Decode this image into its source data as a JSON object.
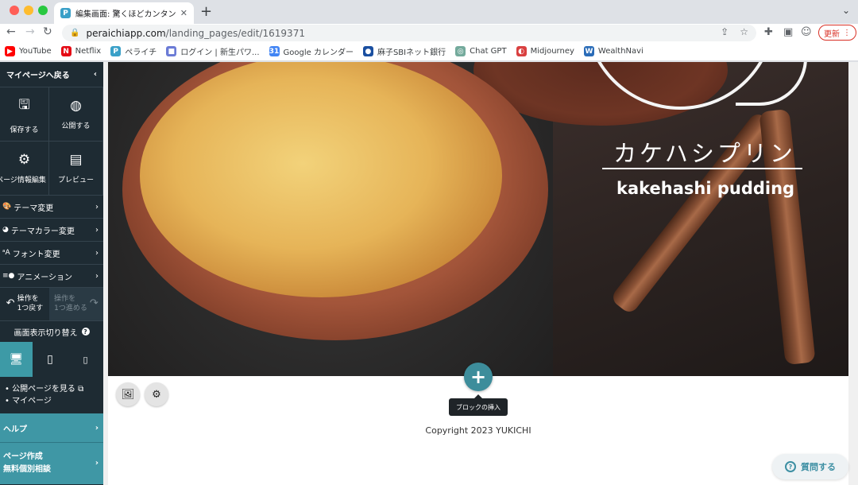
{
  "browser": {
    "tab_title": "編集画面: 驚くほどカンタン！無料",
    "tab_close": "✕",
    "new_tab": "+",
    "url_host": "peraichiapp.com",
    "url_path": "/landing_pages/edit/1619371",
    "update_label": "更新",
    "bookmarks": [
      {
        "label": "YouTube",
        "icon": "youtube-icon",
        "color": "#ff0000"
      },
      {
        "label": "Netflix",
        "icon": "netflix-icon",
        "color": "#e50914"
      },
      {
        "label": "ペライチ",
        "icon": "peraichi-icon",
        "color": "#3aa0c8"
      },
      {
        "label": "ログイン | 新生パワ...",
        "icon": "login-icon",
        "color": "#6b7bd6"
      },
      {
        "label": "Google カレンダー",
        "icon": "calendar-icon",
        "color": "#4285f4"
      },
      {
        "label": "麻子SBIネット銀行",
        "icon": "bank-icon",
        "color": "#1a4fa0"
      },
      {
        "label": "Chat GPT",
        "icon": "chatgpt-icon",
        "color": "#74aa9c"
      },
      {
        "label": "Midjourney",
        "icon": "midjourney-icon",
        "color": "#d94040"
      },
      {
        "label": "WealthNavi",
        "icon": "wealthnavi-icon",
        "color": "#2a6cb8"
      }
    ]
  },
  "sidebar": {
    "back_label": "マイページへ戻る",
    "save_label": "保存する",
    "publish_label": "公開する",
    "page_info_label": "ページ情報編集",
    "preview_label": "プレビュー",
    "menu": [
      {
        "label": "テーマ変更",
        "icon": "palette-icon"
      },
      {
        "label": "テーマカラー変更",
        "icon": "color-palette-icon"
      },
      {
        "label": "フォント変更",
        "icon": "font-icon"
      },
      {
        "label": "アニメーション",
        "icon": "animation-icon"
      }
    ],
    "undo_label_1": "操作を",
    "undo_label_2": "1つ戻す",
    "redo_label_1": "操作を",
    "redo_label_2": "1つ進める",
    "view_switch_label": "画面表示切り替え",
    "links": [
      "公開ページを見る",
      "マイページ"
    ],
    "help_label": "ヘルプ",
    "consult_line1": "ページ作成",
    "consult_line2": "無料個別相談"
  },
  "canvas": {
    "hero_title_jp": "カケハシプリン",
    "hero_title_en": "kakehashi pudding",
    "add_block_tooltip": "ブロックの挿入",
    "copyright": "Copyright 2023 YUKICHI"
  },
  "support": {
    "ask_label": "質問する"
  },
  "colors": {
    "sidebar_bg": "#1e2b33",
    "accent_teal": "#3f97a5"
  }
}
